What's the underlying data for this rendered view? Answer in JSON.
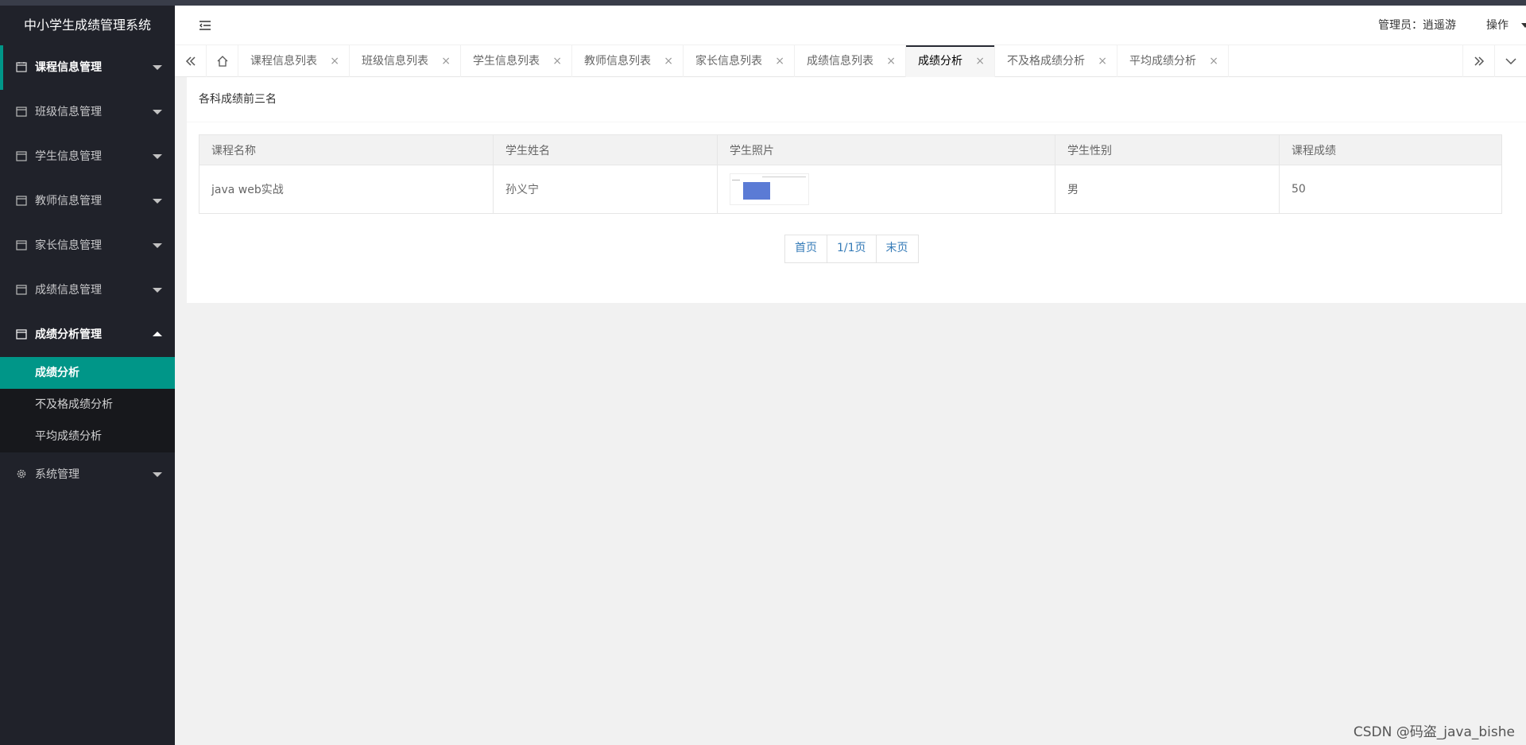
{
  "app": {
    "title": "中小学生成绩管理系统"
  },
  "header": {
    "admin_label": "管理员：逍遥游",
    "ops_label": "操作"
  },
  "sidebar": {
    "items": [
      {
        "label": "课程信息管理",
        "icon": "calendar-icon"
      },
      {
        "label": "班级信息管理",
        "icon": "calendar-icon"
      },
      {
        "label": "学生信息管理",
        "icon": "calendar-icon"
      },
      {
        "label": "教师信息管理",
        "icon": "calendar-icon"
      },
      {
        "label": "家长信息管理",
        "icon": "calendar-icon"
      },
      {
        "label": "成绩信息管理",
        "icon": "calendar-icon"
      },
      {
        "label": "成绩分析管理",
        "icon": "calendar-icon"
      },
      {
        "label": "系统管理",
        "icon": "gear-icon"
      }
    ],
    "sub_items": [
      "成绩分析",
      "不及格成绩分析",
      "平均成绩分析"
    ]
  },
  "tabs": {
    "items": [
      {
        "label": "课程信息列表"
      },
      {
        "label": "班级信息列表"
      },
      {
        "label": "学生信息列表"
      },
      {
        "label": "教师信息列表"
      },
      {
        "label": "家长信息列表"
      },
      {
        "label": "成绩信息列表"
      },
      {
        "label": "成绩分析"
      },
      {
        "label": "不及格成绩分析"
      },
      {
        "label": "平均成绩分析"
      }
    ],
    "close_glyph": "×"
  },
  "main": {
    "card_title": "各科成绩前三名",
    "table": {
      "headers": [
        "课程名称",
        "学生姓名",
        "学生照片",
        "学生性别",
        "课程成绩"
      ],
      "rows": [
        {
          "course": "java web实战",
          "name": "孙义宁",
          "photo": "student-photo-thumbnail",
          "gender": "男",
          "score": "50"
        }
      ]
    },
    "pagination": {
      "first": "首页",
      "page": "1/1页",
      "last": "末页"
    }
  },
  "watermark": "CSDN @码盗_java_bishe",
  "colors": {
    "sidebar_bg": "#20222a",
    "accent": "#009688",
    "link": "#337ab7"
  }
}
